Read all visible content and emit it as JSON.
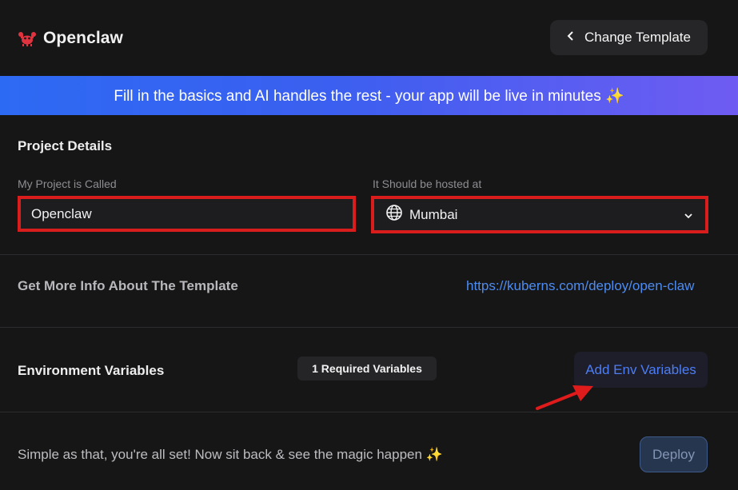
{
  "header": {
    "app_name": "Openclaw",
    "logo_icon": "crab-icon",
    "change_template_label": "Change Template"
  },
  "banner": {
    "text": "Fill in the basics and AI handles the rest - your app will be live in minutes ✨"
  },
  "project_details": {
    "title": "Project Details",
    "name_label": "My Project is Called",
    "name_value": "Openclaw",
    "host_label": "It Should be hosted at",
    "host_value": "Mumbai"
  },
  "template_info": {
    "label": "Get More Info About The Template",
    "link": "https://kuberns.com/deploy/open-claw"
  },
  "env": {
    "title": "Environment Variables",
    "badge": "1 Required Variables",
    "add_label": "Add Env Variables"
  },
  "footer": {
    "text": "Simple as that, you're all set! Now sit back & see the magic happen ✨",
    "deploy_label": "Deploy"
  },
  "colors": {
    "highlight_border": "#d91c1c",
    "accent_link": "#4c8cf2",
    "banner_start": "#2d6af3",
    "banner_end": "#6f5cf2"
  }
}
